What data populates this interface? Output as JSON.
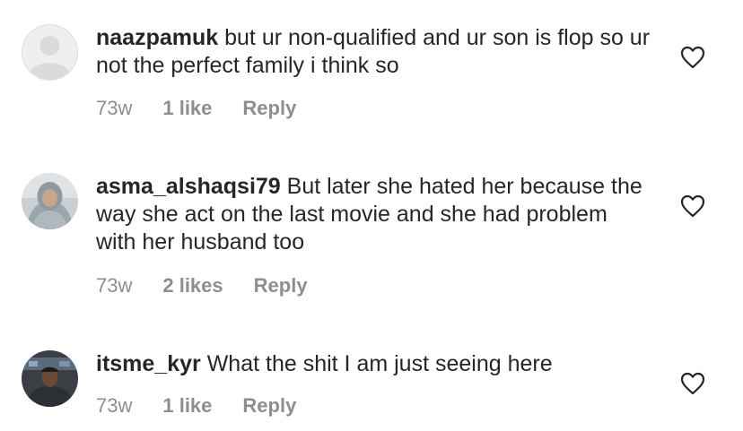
{
  "comments": [
    {
      "username": "naazpamuk",
      "text": "but ur non-qualified and ur son is flop so ur not the perfect family i think so",
      "time": "73w",
      "likes": "1 like",
      "reply": "Reply",
      "avatar": "default-avatar-icon"
    },
    {
      "username": "asma_alshaqsi79",
      "text": "But later she hated her because the way she act on the last movie and she had problem with her husband too",
      "time": "73w",
      "likes": "2 likes",
      "reply": "Reply",
      "avatar": "user-photo"
    },
    {
      "username": "itsme_kyr",
      "text": "What the shit I am just seeing here",
      "time": "73w",
      "likes": "1 like",
      "reply": "Reply",
      "avatar": "user-photo"
    }
  ],
  "colors": {
    "text": "#262626",
    "muted": "#8e8e8e",
    "background": "#ffffff"
  }
}
